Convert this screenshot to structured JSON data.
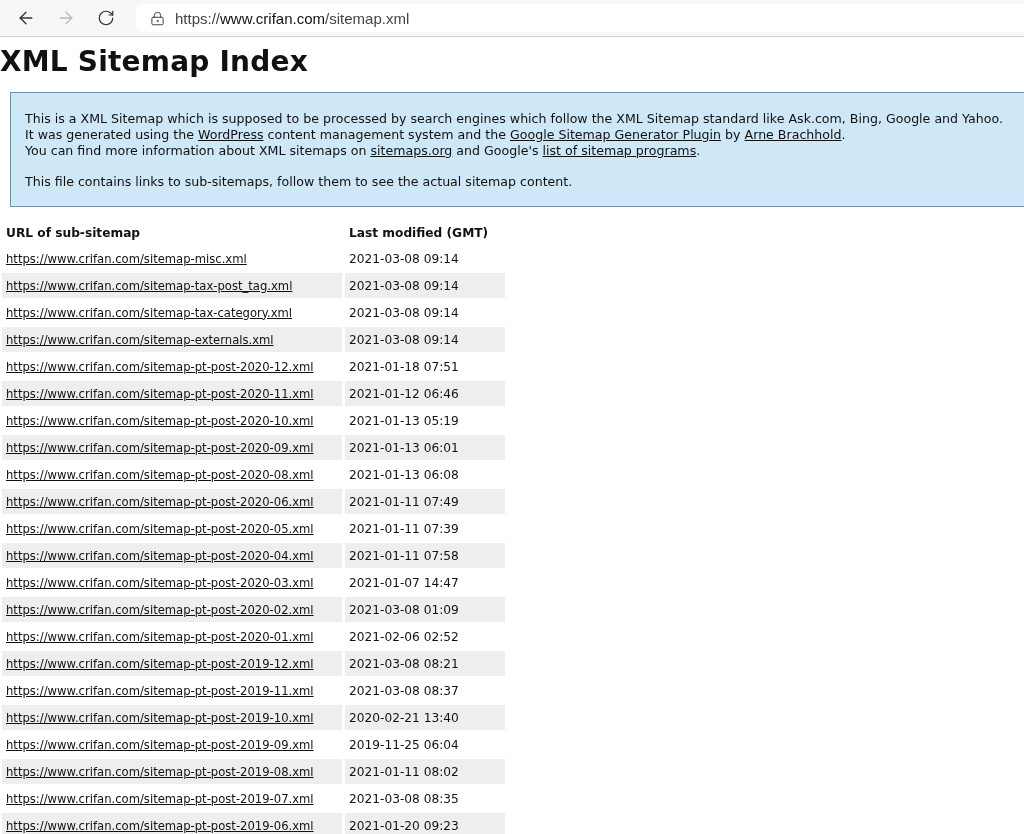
{
  "browser": {
    "nav": [
      {
        "kind": "back",
        "disabled": false
      },
      {
        "kind": "forward",
        "disabled": true
      },
      {
        "kind": "reload",
        "disabled": false
      }
    ],
    "address": "https://**www.crifan.com**/sitemap.xml"
  },
  "title": "XML Sitemap Index",
  "info": {
    "paragraphs": [
      [
        [
          {
            "kind": "text",
            "text": "This is a XML Sitemap which is supposed to be processed by search engines which follow the XML Sitemap standard like Ask.com, Bing, Google and Yahoo."
          }
        ],
        [
          {
            "kind": "text",
            "text": "It was generated using the "
          },
          {
            "kind": "link",
            "text": "WordPress"
          },
          {
            "kind": "text",
            "text": " content management system and the "
          },
          {
            "kind": "link",
            "text": "Google Sitemap Generator Plugin"
          },
          {
            "kind": "text",
            "text": " by "
          },
          {
            "kind": "link",
            "text": "Arne Brachhold"
          },
          {
            "kind": "text",
            "text": "."
          }
        ],
        [
          {
            "kind": "text",
            "text": "You can find more information about XML sitemaps on "
          },
          {
            "kind": "link",
            "text": "sitemaps.org"
          },
          {
            "kind": "text",
            "text": " and Google's "
          },
          {
            "kind": "link",
            "text": "list of sitemap programs"
          },
          {
            "kind": "text",
            "text": "."
          }
        ]
      ],
      [
        [
          {
            "kind": "text",
            "text": "This file contains links to sub-sitemaps, follow them to see the actual sitemap content."
          }
        ]
      ]
    ]
  },
  "table": {
    "columns": [
      "URL of sub-sitemap",
      "Last modified (GMT)"
    ],
    "rows": [
      [
        "https://www.crifan.com/sitemap-misc.xml",
        "2021-03-08 09:14"
      ],
      [
        "https://www.crifan.com/sitemap-tax-post_tag.xml",
        "2021-03-08 09:14"
      ],
      [
        "https://www.crifan.com/sitemap-tax-category.xml",
        "2021-03-08 09:14"
      ],
      [
        "https://www.crifan.com/sitemap-externals.xml",
        "2021-03-08 09:14"
      ],
      [
        "https://www.crifan.com/sitemap-pt-post-2020-12.xml",
        "2021-01-18 07:51"
      ],
      [
        "https://www.crifan.com/sitemap-pt-post-2020-11.xml",
        "2021-01-12 06:46"
      ],
      [
        "https://www.crifan.com/sitemap-pt-post-2020-10.xml",
        "2021-01-13 05:19"
      ],
      [
        "https://www.crifan.com/sitemap-pt-post-2020-09.xml",
        "2021-01-13 06:01"
      ],
      [
        "https://www.crifan.com/sitemap-pt-post-2020-08.xml",
        "2021-01-13 06:08"
      ],
      [
        "https://www.crifan.com/sitemap-pt-post-2020-06.xml",
        "2021-01-11 07:49"
      ],
      [
        "https://www.crifan.com/sitemap-pt-post-2020-05.xml",
        "2021-01-11 07:39"
      ],
      [
        "https://www.crifan.com/sitemap-pt-post-2020-04.xml",
        "2021-01-11 07:58"
      ],
      [
        "https://www.crifan.com/sitemap-pt-post-2020-03.xml",
        "2021-01-07 14:47"
      ],
      [
        "https://www.crifan.com/sitemap-pt-post-2020-02.xml",
        "2021-03-08 01:09"
      ],
      [
        "https://www.crifan.com/sitemap-pt-post-2020-01.xml",
        "2021-02-06 02:52"
      ],
      [
        "https://www.crifan.com/sitemap-pt-post-2019-12.xml",
        "2021-03-08 08:21"
      ],
      [
        "https://www.crifan.com/sitemap-pt-post-2019-11.xml",
        "2021-03-08 08:37"
      ],
      [
        "https://www.crifan.com/sitemap-pt-post-2019-10.xml",
        "2020-02-21 13:40"
      ],
      [
        "https://www.crifan.com/sitemap-pt-post-2019-09.xml",
        "2019-11-25 06:04"
      ],
      [
        "https://www.crifan.com/sitemap-pt-post-2019-08.xml",
        "2021-01-11 08:02"
      ],
      [
        "https://www.crifan.com/sitemap-pt-post-2019-07.xml",
        "2021-03-08 08:35"
      ],
      [
        "https://www.crifan.com/sitemap-pt-post-2019-06.xml",
        "2021-01-20 09:23"
      ]
    ]
  }
}
